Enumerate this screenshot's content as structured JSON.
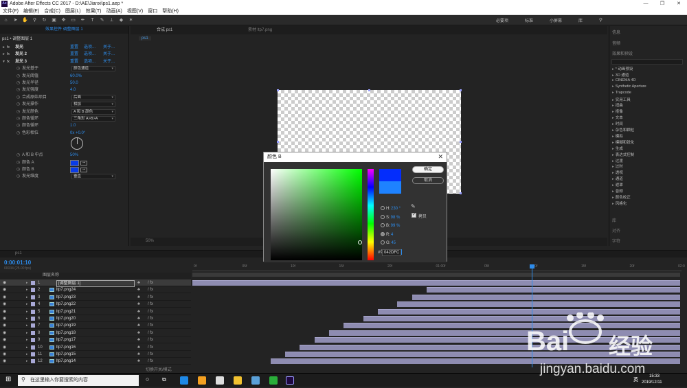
{
  "app": {
    "title": "Adobe After Effects CC 2017 - D:\\AE\\Jianxi\\ps1.aep *",
    "menus": [
      "文件(F)",
      "编辑(E)",
      "合成(C)",
      "图层(L)",
      "效果(T)",
      "动画(A)",
      "视图(V)",
      "窗口",
      "帮助(H)"
    ]
  },
  "toolbar": {
    "workspaces": [
      "必要项",
      "标准",
      "小屏幕",
      "库"
    ]
  },
  "effects_panel": {
    "tab": "效果控件 调整图层 1",
    "breadcrumb": "ps1 • 调整图层 1",
    "effects": [
      {
        "name": "发光",
        "reset": "重置",
        "options": "选项...",
        "about": "关于..."
      },
      {
        "name": "发光 2",
        "reset": "重置",
        "options": "选项...",
        "about": "关于..."
      },
      {
        "name": "发光 3",
        "reset": "重置",
        "options": "选项...",
        "about": "关于..."
      }
    ],
    "props": [
      {
        "label": "发光基于",
        "value": "颜色通道",
        "type": "drop"
      },
      {
        "label": "发光阈值",
        "value": "60.0%",
        "type": "val"
      },
      {
        "label": "发光半径",
        "value": "50.0",
        "type": "val"
      },
      {
        "label": "发光强度",
        "value": "4.0",
        "type": "val"
      },
      {
        "label": "合成原始项目",
        "value": "后面",
        "type": "drop"
      },
      {
        "label": "发光操作",
        "value": "相加",
        "type": "drop"
      },
      {
        "label": "发光颜色",
        "value": "A 和 B 颜色",
        "type": "drop"
      },
      {
        "label": "颜色循环",
        "value": "三角形 A>B>A",
        "type": "drop"
      },
      {
        "label": "颜色循环",
        "value": "1.0",
        "type": "val"
      },
      {
        "label": "色彩相位",
        "value": "0x +0.0°",
        "type": "val"
      },
      {
        "label": "",
        "value": "",
        "type": "dial"
      },
      {
        "label": "A 和 B 中点",
        "value": "50%",
        "type": "val"
      },
      {
        "label": "颜色 A",
        "value": "",
        "type": "color"
      },
      {
        "label": "颜色 B",
        "value": "",
        "type": "color"
      },
      {
        "label": "发光维度",
        "value": "垂直",
        "type": "drop"
      }
    ]
  },
  "comp_viewer": {
    "tab": "合成 ps1",
    "tab2": "素材 ltp7.png",
    "crumb": "ps1",
    "zoom": "50%"
  },
  "right_panel": {
    "sections": [
      "信息",
      "音频",
      "效果和预设"
    ],
    "categories": [
      "* 动画预设",
      "3D 通道",
      "CINEMA 4D",
      "Synthetic Aperture",
      "Trapcode",
      "实用工具",
      "扭曲",
      "抠像",
      "文本",
      "时间",
      "杂色和颗粒",
      "模拟",
      "模糊和锐化",
      "生成",
      "表达式控制",
      "过渡",
      "过时",
      "透视",
      "通道",
      "遮罩",
      "音频",
      "颜色校正",
      "风格化"
    ],
    "bottom": [
      "库",
      "对齐",
      "字符"
    ]
  },
  "color_dialog": {
    "title": "颜色 B",
    "ok": "确定",
    "cancel": "取消",
    "fields": [
      {
        "k": "H:",
        "v": "230 °"
      },
      {
        "k": "S:",
        "v": "98 %"
      },
      {
        "k": "B:",
        "v": "99 %"
      },
      {
        "k": "R:",
        "v": "4"
      },
      {
        "k": "G:",
        "v": "45"
      },
      {
        "k": "B:",
        "v": "252"
      }
    ],
    "hex_label": "#",
    "hex": "042DFC",
    "eyedropper_label": "拷贝",
    "new_color": "#042dfc",
    "old_color": "#1e82ff"
  },
  "timeline": {
    "tab": "ps1",
    "timecode": "0:00:01:10",
    "fps": "00034 (25.00 fps)",
    "col_name": "图层名称",
    "ticks": [
      "0f",
      "05f",
      "10f",
      "15f",
      "20f",
      "01:00f",
      "05f",
      "10f",
      "15f",
      "20f",
      "02:0"
    ],
    "footer": "切换开关/模式",
    "layers": [
      {
        "n": "1",
        "name": "[调整图层 1]"
      },
      {
        "n": "2",
        "name": "ltp7.png24"
      },
      {
        "n": "3",
        "name": "ltp7.png23"
      },
      {
        "n": "4",
        "name": "ltp7.png22"
      },
      {
        "n": "5",
        "name": "ltp7.png21"
      },
      {
        "n": "6",
        "name": "ltp7.png20"
      },
      {
        "n": "7",
        "name": "ltp7.png19"
      },
      {
        "n": "8",
        "name": "ltp7.png18"
      },
      {
        "n": "9",
        "name": "ltp7.png17"
      },
      {
        "n": "10",
        "name": "ltp7.png16"
      },
      {
        "n": "11",
        "name": "ltp7.png15"
      },
      {
        "n": "12",
        "name": "ltp7.png14"
      }
    ],
    "bar_starts": [
      0,
      0.48,
      0.45,
      0.42,
      0.38,
      0.35,
      0.31,
      0.28,
      0.25,
      0.22,
      0.19,
      0.16
    ]
  },
  "taskbar": {
    "search": "在这里输入你要搜索的内容",
    "time": "15:33",
    "date": "2019/12/11",
    "lang": "英"
  },
  "watermark": {
    "brand": "Bai",
    "brand2": "经验",
    "url": "jingyan.baidu.com"
  }
}
